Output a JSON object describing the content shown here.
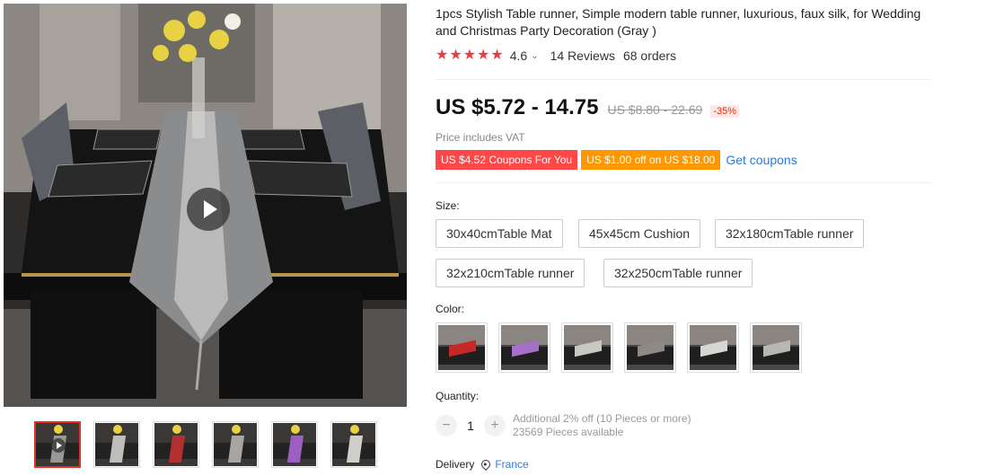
{
  "product": {
    "title": "1pcs Stylish Table runner, Simple modern table runner, luxurious, faux silk, for Wedding and Christmas Party Decoration (Gray )",
    "rating": "4.6",
    "reviews": "14 Reviews",
    "orders": "68 orders",
    "price": "US $5.72 - 14.75",
    "original_price": "US $8.80 - 22.69",
    "discount": "-35%",
    "vat_note": "Price includes VAT"
  },
  "coupons": {
    "coupon1": "US $4.52 Coupons For You",
    "coupon2": "US $1.00 off on US $18.00",
    "get_coupons": "Get coupons"
  },
  "size": {
    "label": "Size:",
    "options": [
      "30x40cmTable Mat",
      "45x45cm Cushion",
      "32x180cmTable runner",
      "32x210cmTable runner",
      "32x250cmTable runner"
    ]
  },
  "color": {
    "label": "Color:",
    "swatch_runner_colors": [
      "#c62828",
      "#a66fc8",
      "#c9c7c2",
      "#8d8a86",
      "#d8d6d2",
      "#b9b7b3"
    ]
  },
  "quantity": {
    "label": "Quantity:",
    "value": "1",
    "minus": "−",
    "plus": "+",
    "discount_note": "Additional 2% off (10 Pieces or more)",
    "available": "23569 Pieces available"
  },
  "delivery": {
    "label": "Delivery",
    "country": "France"
  },
  "gallery": {
    "thumb_runner_colors": [
      "#9a9894",
      "#bfbdb9",
      "#b33030",
      "#a8a6a2",
      "#9c5fc0",
      "#d0cec9"
    ],
    "star_color": "#ea3e3e",
    "accent": "#e43225"
  }
}
